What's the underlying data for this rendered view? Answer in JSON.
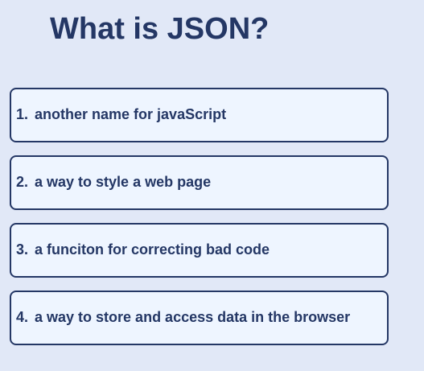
{
  "quiz": {
    "question": "What is JSON?",
    "answers": [
      {
        "number": "1.",
        "text": "another name for javaScript"
      },
      {
        "number": "2.",
        "text": "a way to style a web page"
      },
      {
        "number": "3.",
        "text": "a funciton for correcting bad code"
      },
      {
        "number": "4.",
        "text": "a way to store and access data in the browser"
      }
    ]
  }
}
